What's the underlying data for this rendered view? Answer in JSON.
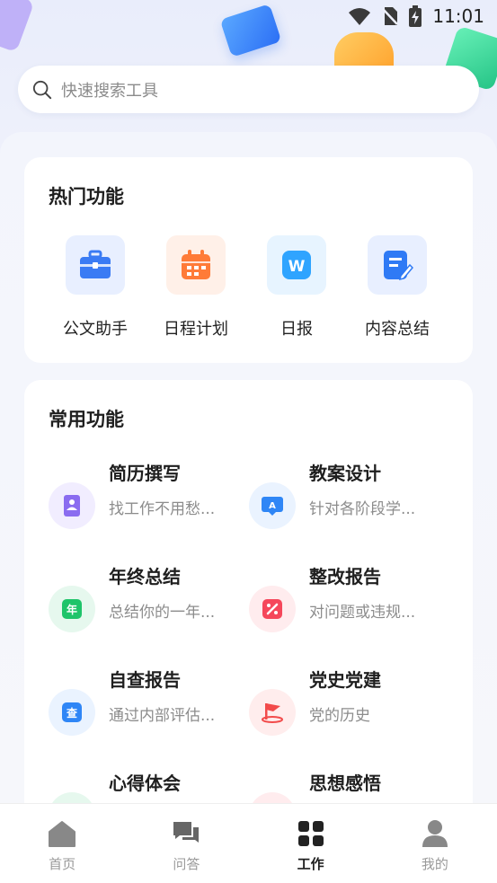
{
  "status_bar": {
    "time": "11:01",
    "icons": [
      "wifi-icon",
      "no-sim-icon",
      "battery-charging-icon"
    ]
  },
  "search": {
    "placeholder": "快速搜索工具"
  },
  "hot": {
    "title": "热门功能",
    "items": [
      {
        "label": "公文助手",
        "icon": "briefcase-icon",
        "color": "#3a7bf4",
        "bg": "#e8efff"
      },
      {
        "label": "日程计划",
        "icon": "calendar-icon",
        "color": "#ff7b38",
        "bg": "#fff0e8"
      },
      {
        "label": "日报",
        "icon": "word-doc-icon",
        "color": "#2fa4ff",
        "bg": "#e7f4ff"
      },
      {
        "label": "内容总结",
        "icon": "edit-document-icon",
        "color": "#2f7af5",
        "bg": "#e8efff"
      }
    ]
  },
  "common": {
    "title": "常用功能",
    "items": [
      {
        "title": "简历撰写",
        "subtitle": "找工作不用愁...",
        "icon": "resume-icon",
        "color": "#8a6cf0",
        "bg": "#f1edff"
      },
      {
        "title": "教案设计",
        "subtitle": "针对各阶段学...",
        "icon": "lesson-plan-icon",
        "color": "#2f86f6",
        "bg": "#eaf3ff"
      },
      {
        "title": "年终总结",
        "subtitle": "总结你的一年...",
        "icon": "year-summary-icon",
        "color": "#1fc46a",
        "bg": "#e6f8ee"
      },
      {
        "title": "整改报告",
        "subtitle": "对问题或违规...",
        "icon": "rectify-report-icon",
        "color": "#f5475b",
        "bg": "#ffecee"
      },
      {
        "title": "自查报告",
        "subtitle": "通过内部评估...",
        "icon": "self-check-icon",
        "color": "#2f86f6",
        "bg": "#eaf3ff"
      },
      {
        "title": "党史党建",
        "subtitle": "党的历史",
        "icon": "party-flag-icon",
        "color": "#f24b4b",
        "bg": "#ffeded"
      },
      {
        "title": "心得体会",
        "subtitle": "",
        "icon": "reflection-icon",
        "color": "#1fc46a",
        "bg": "#e6f8ee"
      },
      {
        "title": "思想感悟",
        "subtitle": "",
        "icon": "thought-icon",
        "color": "#f5475b",
        "bg": "#ffecee"
      }
    ]
  },
  "nav": {
    "active": "工作",
    "items": [
      {
        "label": "首页",
        "icon": "home-icon"
      },
      {
        "label": "问答",
        "icon": "chat-icon"
      },
      {
        "label": "工作",
        "icon": "work-grid-icon"
      },
      {
        "label": "我的",
        "icon": "profile-icon"
      }
    ]
  }
}
